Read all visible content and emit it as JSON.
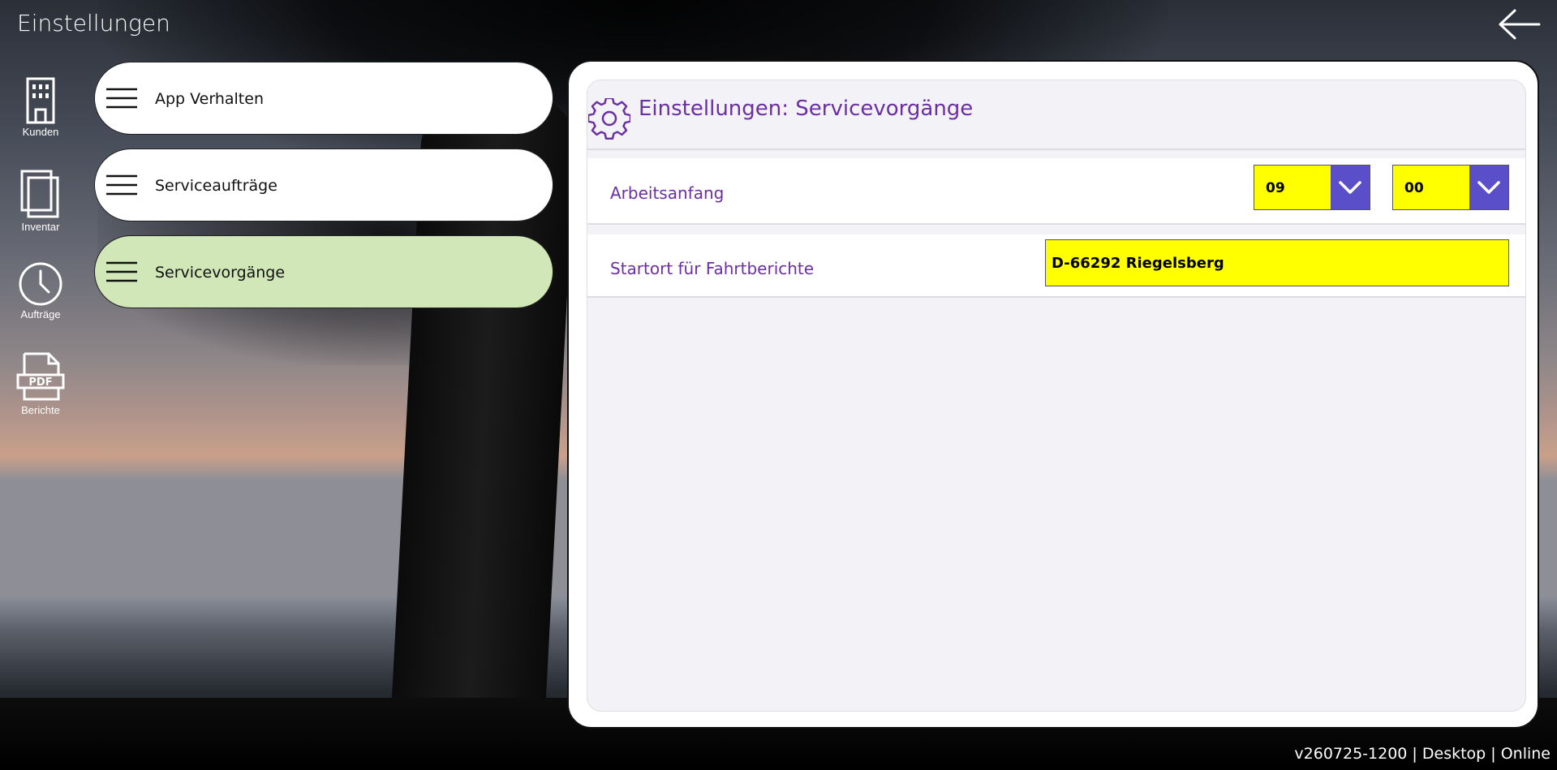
{
  "header": {
    "title": "Einstellungen",
    "back_icon": "arrow-left-icon"
  },
  "rail": [
    {
      "label": "Kunden",
      "icon": "building-icon"
    },
    {
      "label": "Inventar",
      "icon": "documents-icon"
    },
    {
      "label": "Aufträge",
      "icon": "clock-icon"
    },
    {
      "label": "Berichte",
      "icon": "pdf-icon"
    }
  ],
  "menu": [
    {
      "label": "App Verhalten",
      "active": false
    },
    {
      "label": "Serviceaufträge",
      "active": false
    },
    {
      "label": "Servicevorgänge",
      "active": true
    }
  ],
  "panel": {
    "title": "Einstellungen: Servicevorgänge",
    "icon": "gear-icon",
    "rows": {
      "arbeitsanfang": {
        "label": "Arbeitsanfang",
        "hour": "09",
        "minute": "00"
      },
      "startort": {
        "label": "Startort für Fahrtberichte",
        "value": "D-66292 Riegelsberg"
      }
    }
  },
  "status": "v260725-1200 | Desktop | Online",
  "colors": {
    "accent_text": "#6b2fa3",
    "input_bg": "#ffff00",
    "dropdown_button": "#5b4fc9",
    "active_menu": "#d1e7b7"
  }
}
